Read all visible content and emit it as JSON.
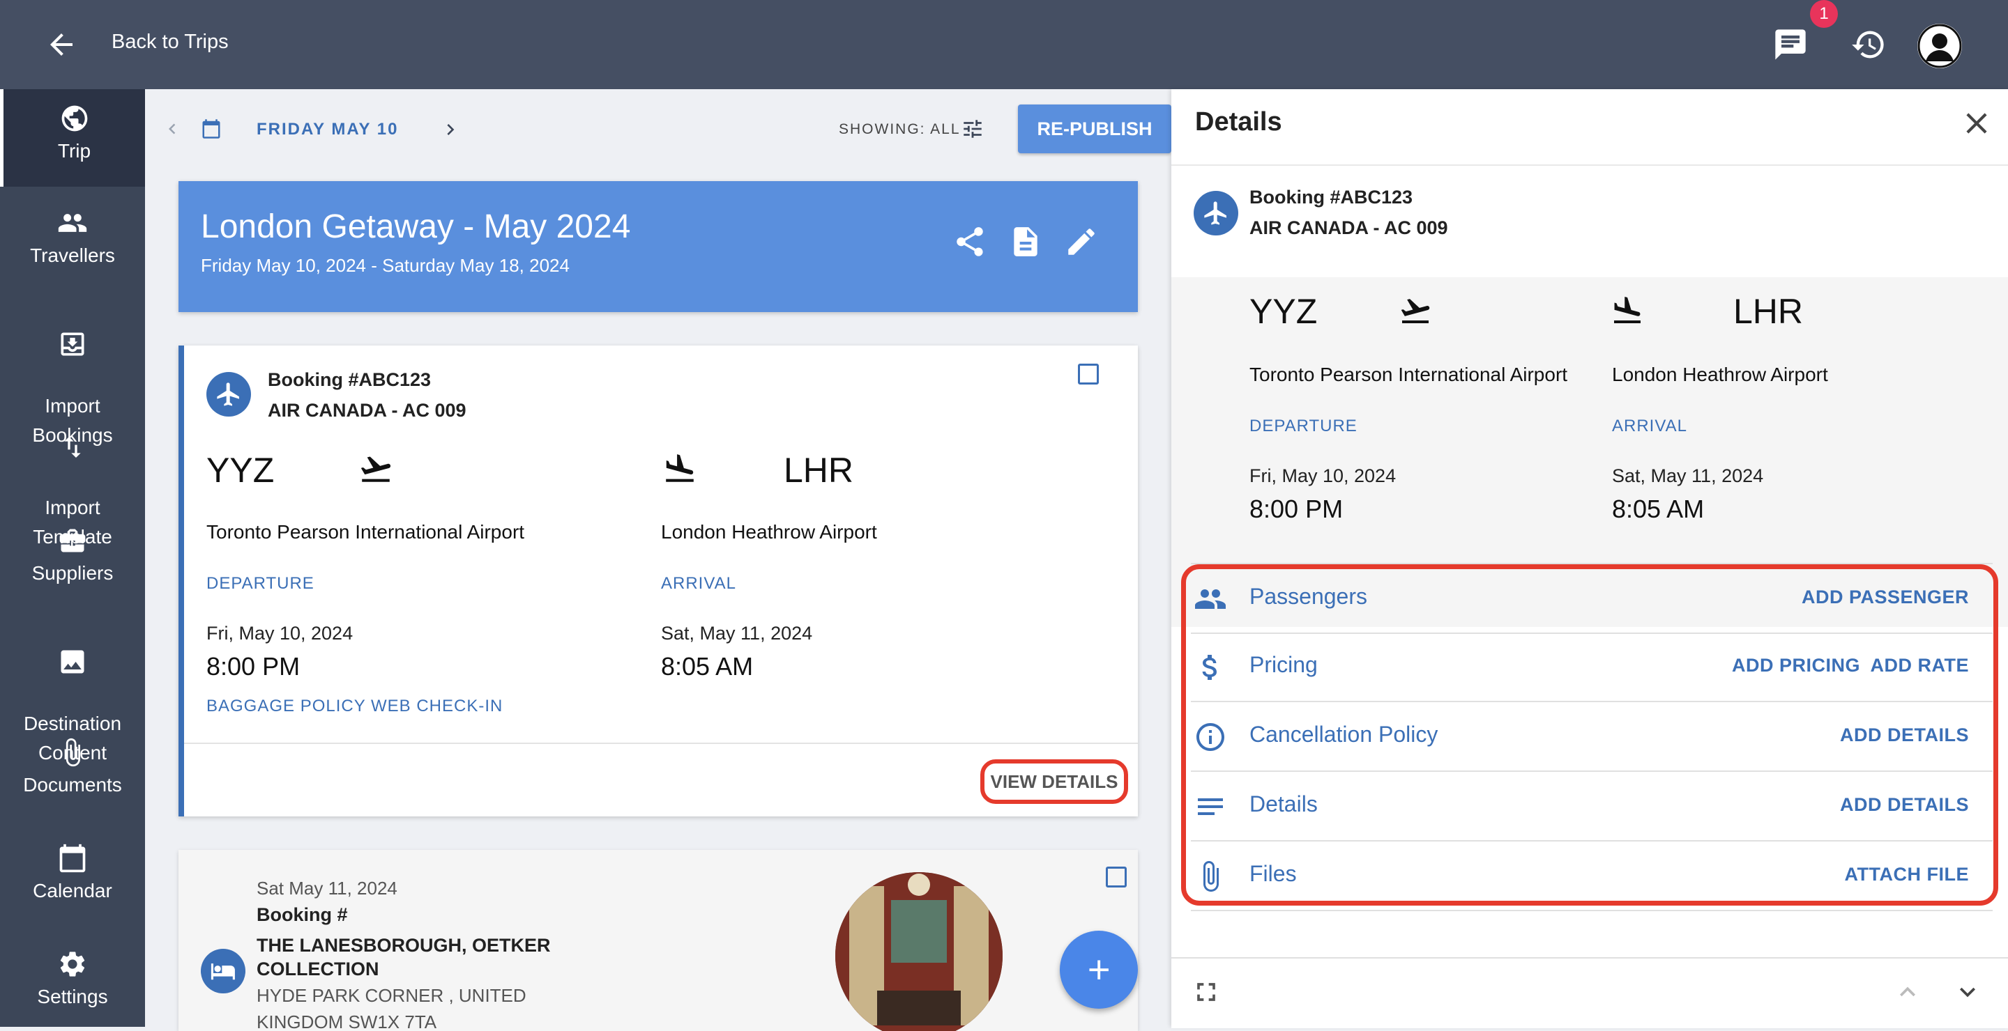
{
  "topbar": {
    "back_label": "Back to Trips",
    "badge_count": "1"
  },
  "sidebar": {
    "items": [
      {
        "label": "Trip",
        "icon": "globe-icon"
      },
      {
        "label": "Travellers",
        "icon": "people-icon"
      },
      {
        "label": "Import\nBookings",
        "icon": "import-icon"
      },
      {
        "label": "Import\nTemplate",
        "icon": "swap-vertical-icon"
      },
      {
        "label": "Suppliers",
        "icon": "briefcase-icon"
      },
      {
        "label": "Destination\nContent",
        "icon": "image-icon"
      },
      {
        "label": "Documents",
        "icon": "paperclip-icon"
      },
      {
        "label": "Calendar",
        "icon": "calendar-icon"
      },
      {
        "label": "Settings",
        "icon": "gear-icon"
      }
    ]
  },
  "datenav": {
    "date_label": "FRIDAY MAY 10",
    "showing_label": "SHOWING: ALL",
    "republish_label": "RE-PUBLISH"
  },
  "trip": {
    "title": "London Getaway - May 2024",
    "dates": "Friday May 10, 2024 - Saturday May 18, 2024"
  },
  "flight_card": {
    "booking": "Booking #ABC123",
    "airline": "AIR CANADA - AC 009",
    "departure": {
      "code": "YYZ",
      "airport": "Toronto Pearson International Airport",
      "label": "DEPARTURE",
      "date": "Fri, May 10, 2024",
      "time": "8:00 PM"
    },
    "arrival": {
      "code": "LHR",
      "airport": "London Heathrow Airport",
      "label": "ARRIVAL",
      "date": "Sat, May 11, 2024",
      "time": "8:05 AM"
    },
    "links": [
      "BAGGAGE POLICY",
      "WEB CHECK-IN"
    ],
    "view_details": "VIEW DETAILS"
  },
  "hotel_card": {
    "date": "Sat May 11, 2024",
    "booking": "Booking #",
    "name_line1": "THE LANESBOROUGH, OETKER",
    "name_line2": "COLLECTION",
    "address_line1": "HYDE PARK CORNER , UNITED",
    "address_line2": "KINGDOM SW1X 7TA"
  },
  "panel": {
    "title": "Details",
    "booking": "Booking #ABC123",
    "airline": "AIR CANADA - AC 009",
    "departure": {
      "code": "YYZ",
      "airport": "Toronto Pearson International Airport",
      "label": "DEPARTURE",
      "date": "Fri, May 10, 2024",
      "time": "8:00 PM"
    },
    "arrival": {
      "code": "LHR",
      "airport": "London Heathrow Airport",
      "label": "ARRIVAL",
      "date": "Sat, May 11, 2024",
      "time": "8:05 AM"
    },
    "sections": {
      "passengers": {
        "label": "Passengers",
        "action": "ADD PASSENGER"
      },
      "pricing": {
        "label": "Pricing",
        "action1": "ADD PRICING",
        "action2": "ADD RATE"
      },
      "cancellation": {
        "label": "Cancellation Policy",
        "action": "ADD DETAILS"
      },
      "details": {
        "label": "Details",
        "action": "ADD DETAILS"
      },
      "files": {
        "label": "Files",
        "action": "ATTACH FILE"
      }
    }
  },
  "colors": {
    "topbar": "#454f63",
    "sidebar": "#3c4658",
    "accent": "#3b6fb6",
    "header_card": "#5a8fdd",
    "highlight": "#e53a2c"
  }
}
